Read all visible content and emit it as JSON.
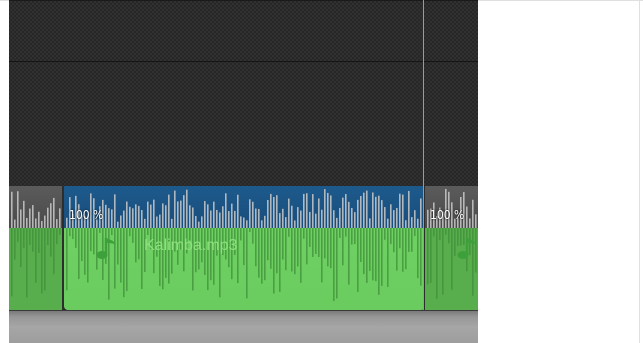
{
  "timeline": {
    "clips": [
      {
        "id": "left",
        "gain": "",
        "name": ""
      },
      {
        "id": "main",
        "gain": "100 %",
        "name": "Kalimba.mp3"
      },
      {
        "id": "right",
        "gain": "100 %",
        "name": ""
      }
    ],
    "icons": {
      "clip_type": "music-note-icon"
    },
    "colors": {
      "track_background": "#262626",
      "clip_top_band": "#1d5a8c",
      "clip_bottom_band": "#6fd163",
      "clip_name_text": "#8fe07f",
      "playhead": "#9a9a9a"
    }
  }
}
